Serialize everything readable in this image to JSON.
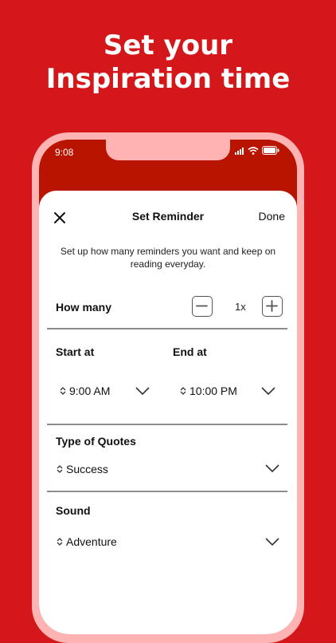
{
  "headline": {
    "line1": "Set your",
    "line2": "Inspiration time"
  },
  "status_bar": {
    "time": "9:08"
  },
  "nav": {
    "title": "Set Reminder",
    "done_label": "Done"
  },
  "description": "Set up how many reminders you want and keep  on reading everyday.",
  "how_many": {
    "label": "How many",
    "count": "1x"
  },
  "start": {
    "label": "Start at",
    "value": "9:00 AM"
  },
  "end": {
    "label": "End at",
    "value": "10:00 PM"
  },
  "quote_type": {
    "label": "Type of Quotes",
    "value": "Success"
  },
  "sound": {
    "label": "Sound",
    "value": "Adventure"
  },
  "colors": {
    "background": "#d3171b",
    "phone_frame": "#ffb3b3",
    "header": "#b91400"
  }
}
